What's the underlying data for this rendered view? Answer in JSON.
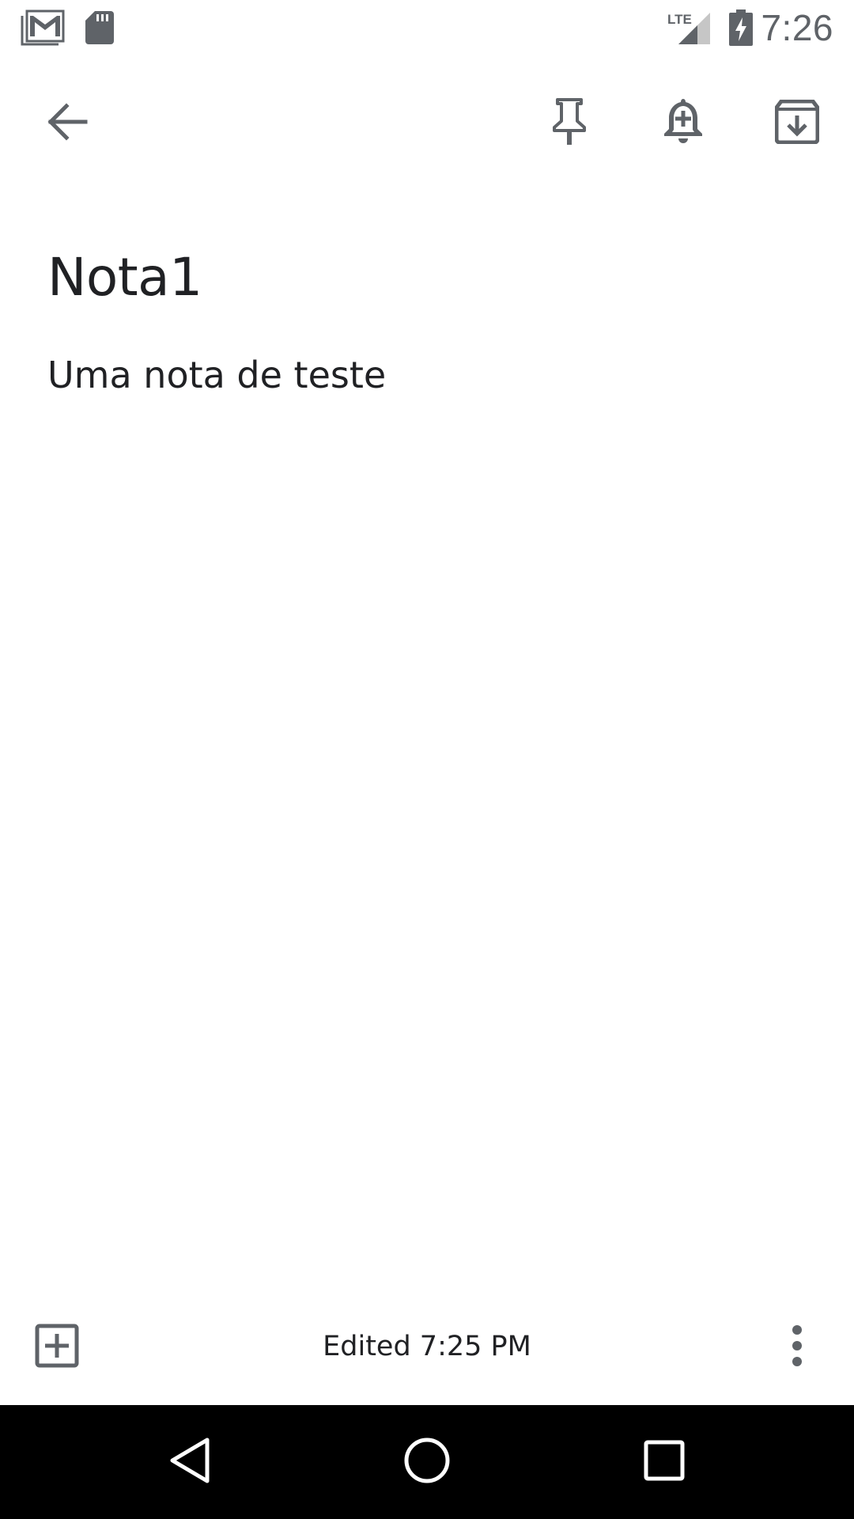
{
  "status_bar": {
    "time": "7:26",
    "network_label": "LTE",
    "icons": [
      "gmail-icon",
      "sd-card-icon",
      "lte-signal-icon",
      "battery-charging-icon"
    ]
  },
  "toolbar": {
    "icons": [
      "back-arrow-icon",
      "pin-icon",
      "add-reminder-icon",
      "archive-icon"
    ]
  },
  "note": {
    "title": "Nota1",
    "body": "Uma nota de teste"
  },
  "bottom_bar": {
    "edited_text": "Edited 7:25 PM",
    "icons": [
      "add-box-icon",
      "more-vert-icon"
    ]
  },
  "nav_bar": {
    "icons": [
      "nav-back-icon",
      "nav-home-icon",
      "nav-recents-icon"
    ]
  },
  "colors": {
    "icon_gray": "#5f6368",
    "text": "#202124",
    "nav_background": "#000000"
  }
}
